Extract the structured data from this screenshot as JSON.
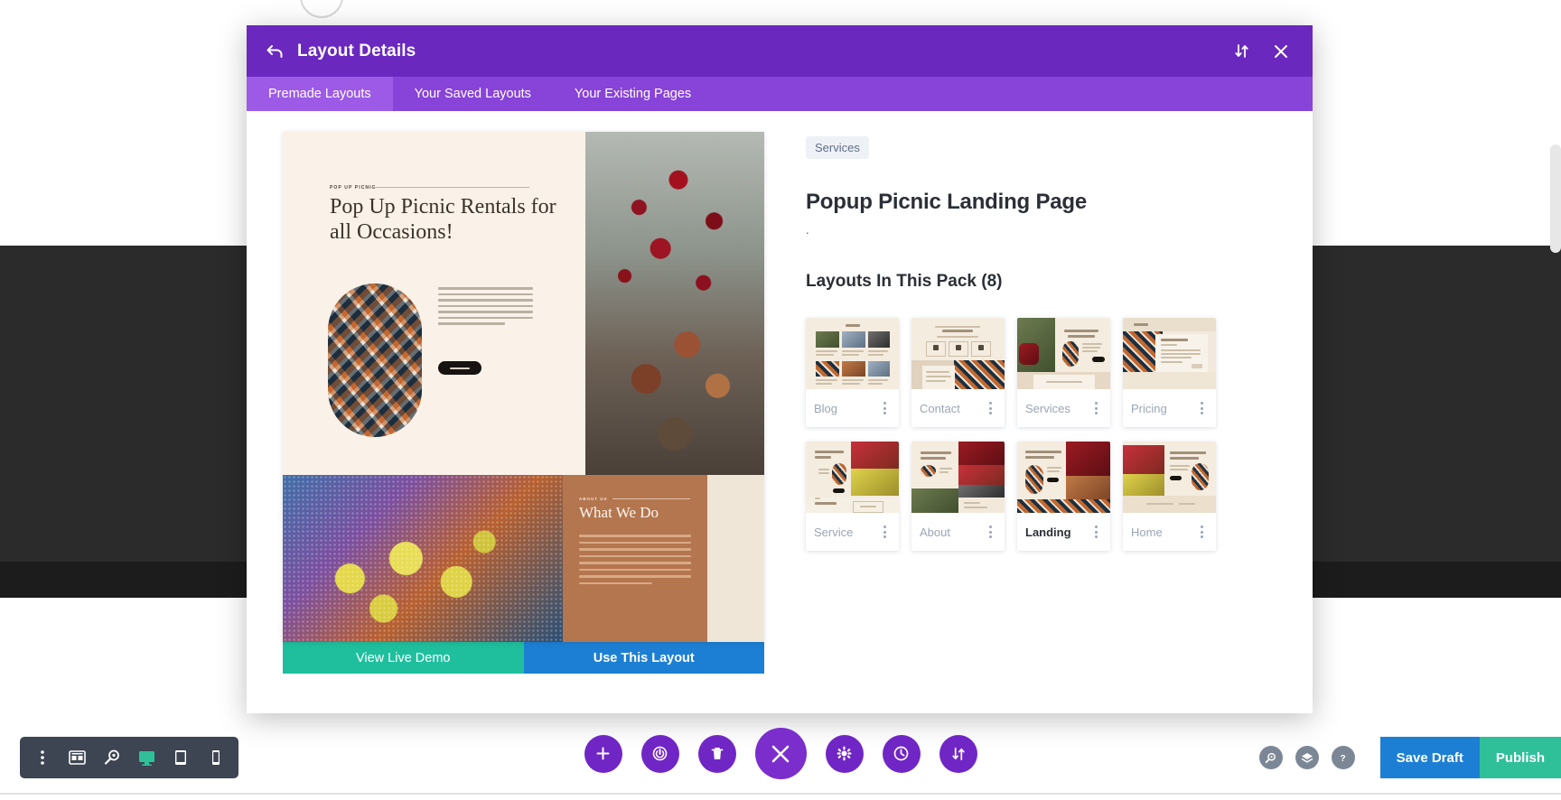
{
  "modal": {
    "title": "Layout Details",
    "back_icon": "back-arrow-icon",
    "sort_icon": "sort-updown-icon",
    "close_icon": "close-x-icon",
    "tabs": [
      {
        "label": "Premade Layouts",
        "active": true
      },
      {
        "label": "Your Saved Layouts",
        "active": false
      },
      {
        "label": "Your Existing Pages",
        "active": false
      }
    ]
  },
  "preview": {
    "eyebrow": "POP UP PICNIC",
    "headline": "Pop Up Picnic Rentals for all Occasions!",
    "lower_eyebrow": "ABOUT US",
    "lower_headline": "What We Do",
    "actions": {
      "demo_label": "View Live Demo",
      "use_label": "Use This Layout"
    }
  },
  "details": {
    "category": "Services",
    "title": "Popup Picnic Landing Page",
    "description": ".",
    "pack_heading": "Layouts In This Pack (8)",
    "layouts": [
      {
        "label": "Blog",
        "active": false,
        "kebab": "more-options-icon"
      },
      {
        "label": "Contact",
        "active": false,
        "kebab": "more-options-icon"
      },
      {
        "label": "Services",
        "active": false,
        "kebab": "more-options-icon"
      },
      {
        "label": "Pricing",
        "active": false,
        "kebab": "more-options-icon"
      },
      {
        "label": "Service",
        "active": false,
        "kebab": "more-options-icon"
      },
      {
        "label": "About",
        "active": false,
        "kebab": "more-options-icon"
      },
      {
        "label": "Landing",
        "active": true,
        "kebab": "more-options-icon"
      },
      {
        "label": "Home",
        "active": false,
        "kebab": "more-options-icon"
      }
    ]
  },
  "toolbar_left": {
    "items": [
      {
        "icon": "more-vertical-icon",
        "active": false
      },
      {
        "icon": "wireframe-icon",
        "active": false
      },
      {
        "icon": "zoom-icon",
        "active": false
      },
      {
        "icon": "desktop-icon",
        "active": true
      },
      {
        "icon": "tablet-icon",
        "active": false
      },
      {
        "icon": "phone-icon",
        "active": false
      }
    ]
  },
  "toolbar_center": {
    "items": [
      {
        "icon": "plus-icon",
        "big": false
      },
      {
        "icon": "power-icon",
        "big": false
      },
      {
        "icon": "trash-icon",
        "big": false
      },
      {
        "icon": "close-x-icon",
        "big": true
      },
      {
        "icon": "gear-icon",
        "big": false
      },
      {
        "icon": "history-icon",
        "big": false
      },
      {
        "icon": "sort-updown-icon",
        "big": false
      }
    ]
  },
  "toolbar_right": {
    "icons": [
      {
        "icon": "search-icon"
      },
      {
        "icon": "layers-icon"
      },
      {
        "icon": "help-icon"
      }
    ],
    "save_label": "Save Draft",
    "publish_label": "Publish"
  },
  "colors": {
    "modal_header": "#6a28bf",
    "tabs_bar": "#8843d9",
    "tab_active": "#9d5ae6",
    "demo_green": "#1fbf9e",
    "use_blue": "#1d7fd4",
    "dock_purple": "#7026c5",
    "publish_green": "#2fc09a",
    "toolbar_dark": "#3c4551"
  }
}
